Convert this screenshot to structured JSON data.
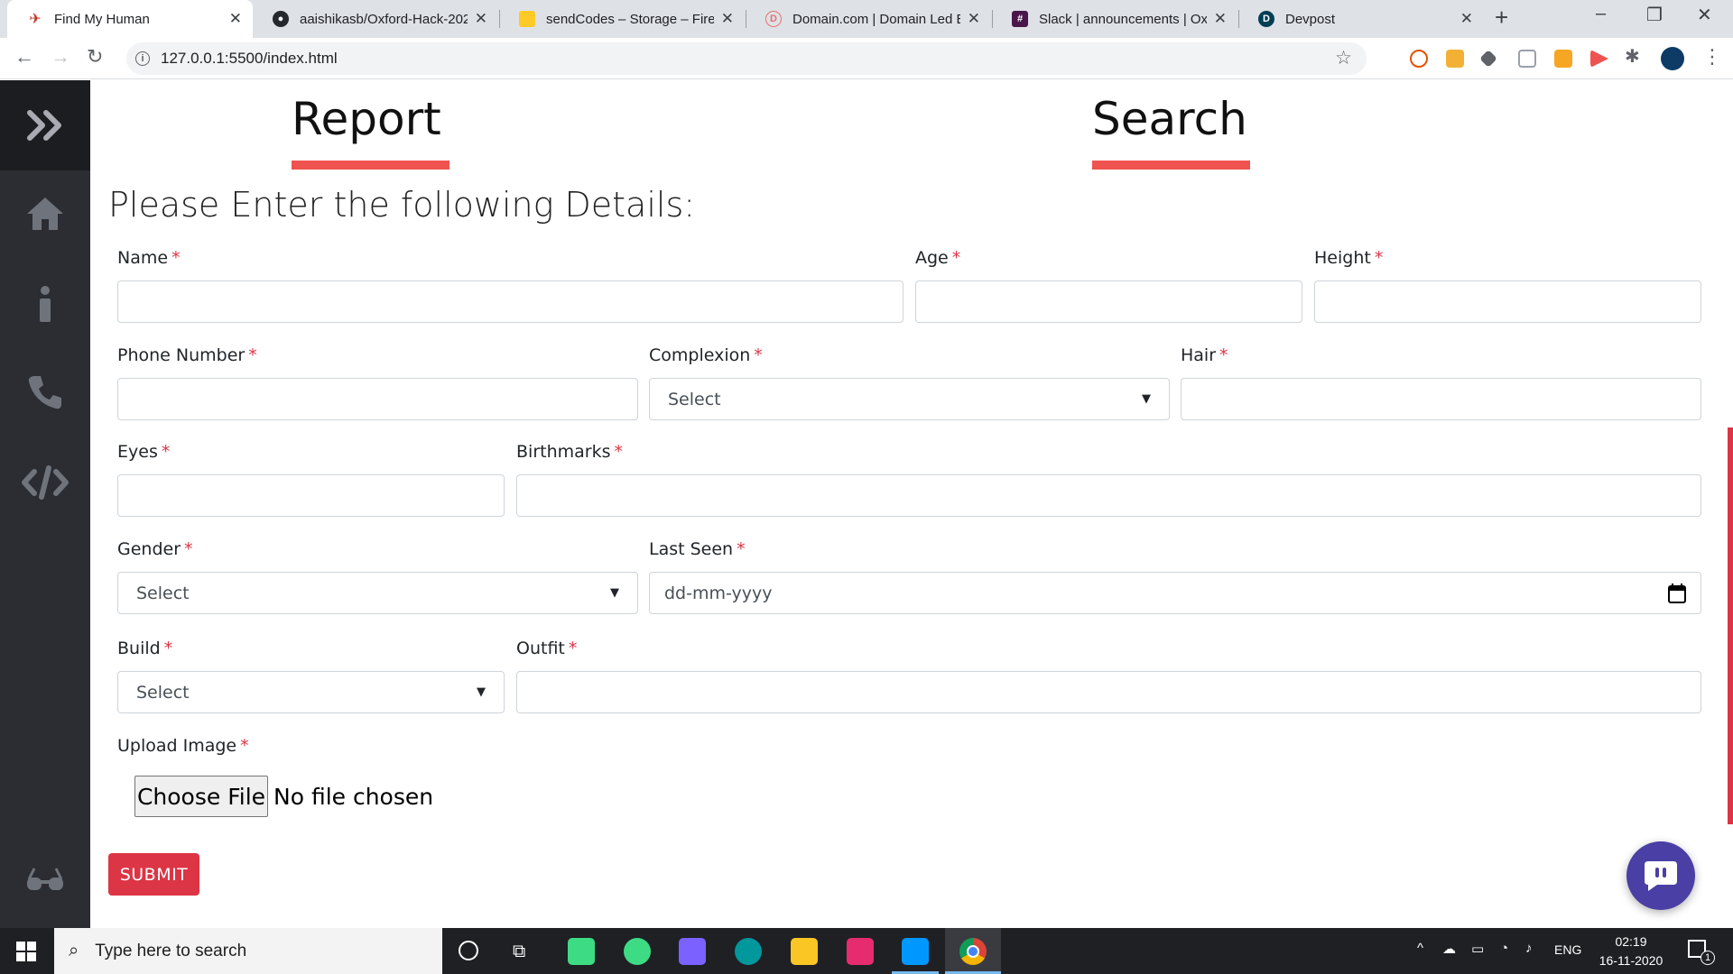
{
  "browser": {
    "tabs": [
      {
        "title": "Find My Human",
        "icon": "fmh-favicon",
        "active": true
      },
      {
        "title": "aaishikasb/Oxford-Hack-202",
        "icon": "github-icon",
        "active": false
      },
      {
        "title": "sendCodes – Storage – Fireb",
        "icon": "firebase-icon",
        "active": false
      },
      {
        "title": "Domain.com | Domain Led E",
        "icon": "domain-icon",
        "active": false
      },
      {
        "title": "Slack | announcements | Oxf",
        "icon": "slack-icon",
        "active": false
      },
      {
        "title": "Devpost",
        "icon": "devpost-icon",
        "active": false
      }
    ],
    "new_tab": "+",
    "url": "127.0.0.1:5500/index.html"
  },
  "page": {
    "tabs": {
      "report": "Report",
      "search": "Search"
    },
    "lead": "Please Enter the following Details:",
    "required_mark": "*",
    "fields": {
      "name": {
        "label": "Name",
        "value": ""
      },
      "age": {
        "label": "Age",
        "value": ""
      },
      "height": {
        "label": "Height",
        "value": ""
      },
      "phone": {
        "label": "Phone Number",
        "value": ""
      },
      "complexion": {
        "label": "Complexion",
        "selected": "Select"
      },
      "hair": {
        "label": "Hair",
        "value": ""
      },
      "eyes": {
        "label": "Eyes",
        "value": ""
      },
      "birthmarks": {
        "label": "Birthmarks",
        "value": ""
      },
      "gender": {
        "label": "Gender",
        "selected": "Select"
      },
      "last_seen": {
        "label": "Last Seen",
        "placeholder": "dd-mm-yyyy"
      },
      "build": {
        "label": "Build",
        "selected": "Select"
      },
      "outfit": {
        "label": "Outfit",
        "value": ""
      },
      "upload": {
        "label": "Upload Image",
        "button": "Choose File",
        "status": "No file chosen"
      }
    },
    "submit": "SUBMIT"
  },
  "taskbar": {
    "search_placeholder": "Type here to search",
    "lang": "ENG",
    "time": "02:19",
    "date": "16-11-2020",
    "notifications": "1"
  },
  "colors": {
    "accent_red": "#dc3545",
    "underline": "#ef5350",
    "sidebar": "#2b2d33",
    "chat": "#4a3fa5"
  }
}
